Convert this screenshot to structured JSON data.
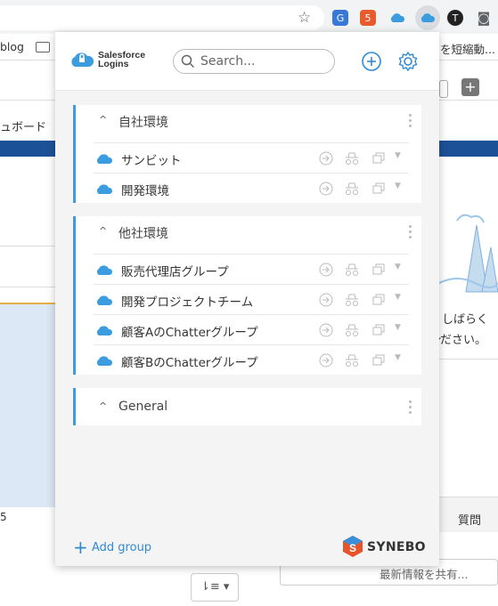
{
  "browser": {
    "bookmarks": {
      "left_text": "blog",
      "right_text": "を短縮動..."
    }
  },
  "background_page": {
    "dashboard_tab": "ュボード",
    "axis_tick": "5",
    "message_line1": "、しばらくし",
    "message_line2": "ださい。",
    "question_label": "質問",
    "share_placeholder": "最新情報を共有..."
  },
  "popup": {
    "logo_line1": "Salesforce",
    "logo_line2": "Logins",
    "search_placeholder": "Search...",
    "groups": [
      {
        "title": "自社環境",
        "items": [
          {
            "label": "サンビット"
          },
          {
            "label": "開発環境"
          }
        ]
      },
      {
        "title": "他社環境",
        "items": [
          {
            "label": "販売代理店グループ"
          },
          {
            "label": "開発プロジェクトチーム"
          },
          {
            "label": "顧客AのChatterグループ"
          },
          {
            "label": "顧客BのChatterグループ"
          }
        ]
      },
      {
        "title": "General",
        "items": []
      }
    ],
    "add_group_label": "Add group",
    "brand": "SYNEBO"
  },
  "colors": {
    "accent": "#2f8ad4",
    "cloud": "#3b9de0",
    "border_accent": "#3b9de0"
  }
}
